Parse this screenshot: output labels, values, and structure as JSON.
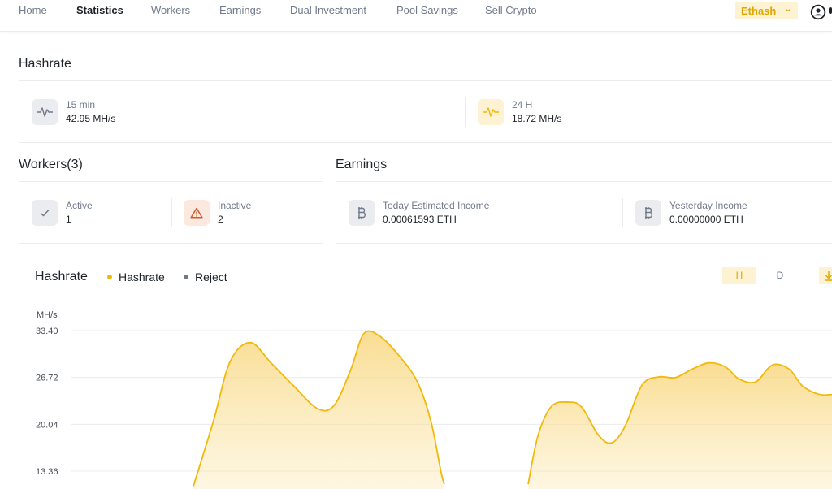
{
  "nav": {
    "items": [
      {
        "label": "Home",
        "active": false
      },
      {
        "label": "Statistics",
        "active": true
      },
      {
        "label": "Workers",
        "active": false
      },
      {
        "label": "Earnings",
        "active": false
      },
      {
        "label": "Dual Investment",
        "active": false
      },
      {
        "label": "Pool Savings",
        "active": false
      },
      {
        "label": "Sell Crypto",
        "active": false
      }
    ],
    "algorithm": "Ethash",
    "user_icon": "user-circle-icon"
  },
  "hashrate_section": {
    "title": "Hashrate",
    "min15": {
      "label": "15 min",
      "value": "42.95 MH/s",
      "icon": "pulse-icon"
    },
    "h24": {
      "label": "24 H",
      "value": "18.72 MH/s",
      "icon": "pulse-icon"
    }
  },
  "workers_section": {
    "title": "Workers(3)",
    "active": {
      "label": "Active",
      "value": "1",
      "icon": "check-icon"
    },
    "inactive": {
      "label": "Inactive",
      "value": "2",
      "icon": "warning-icon"
    }
  },
  "earnings_section": {
    "title": "Earnings",
    "today": {
      "label": "Today Estimated Income",
      "value": "0.00061593 ETH",
      "icon": "bitcoin-icon"
    },
    "yesterday": {
      "label": "Yesterday Income",
      "value": "0.00000000 ETH",
      "icon": "bitcoin-icon"
    }
  },
  "chart_header": {
    "title": "Hashrate",
    "legend": [
      "Hashrate",
      "Reject"
    ],
    "ranges": [
      "H",
      "D"
    ],
    "active_range": "H",
    "download_icon": "download-icon"
  },
  "colors": {
    "accent": "#f0b90b",
    "accent_light": "#fdf2d2",
    "reject": "#707a8a",
    "text": "#1e2329",
    "muted": "#707a8a"
  },
  "chart_data": {
    "type": "area",
    "ylabel": "MH/s",
    "ticks": [
      "33.40",
      "26.72",
      "20.04",
      "13.36"
    ],
    "tick_values": [
      33.4,
      26.72,
      20.04,
      13.36
    ],
    "series": [
      {
        "name": "Hashrate",
        "segments": [
          [
            [
              0.0,
              11.2
            ],
            [
              0.6,
              20.5
            ],
            [
              1.1,
              29.0
            ],
            [
              1.7,
              31.7
            ],
            [
              2.3,
              28.9
            ],
            [
              3.0,
              25.5
            ],
            [
              3.7,
              22.3
            ],
            [
              4.2,
              22.7
            ],
            [
              4.7,
              27.8
            ],
            [
              5.1,
              33.0
            ],
            [
              5.6,
              32.5
            ],
            [
              6.2,
              29.5
            ],
            [
              6.7,
              26.0
            ],
            [
              7.1,
              20.4
            ],
            [
              7.4,
              13.2
            ],
            [
              7.5,
              11.5
            ]
          ],
          [
            [
              10.0,
              11.5
            ],
            [
              10.3,
              18.5
            ],
            [
              10.7,
              22.6
            ],
            [
              11.2,
              23.2
            ],
            [
              11.6,
              22.5
            ],
            [
              12.1,
              18.5
            ],
            [
              12.5,
              17.4
            ],
            [
              12.9,
              19.8
            ],
            [
              13.4,
              25.6
            ],
            [
              13.9,
              26.8
            ],
            [
              14.4,
              26.7
            ],
            [
              14.9,
              27.9
            ],
            [
              15.4,
              28.8
            ],
            [
              15.9,
              28.2
            ],
            [
              16.3,
              26.5
            ],
            [
              16.8,
              26.1
            ],
            [
              17.3,
              28.5
            ],
            [
              17.8,
              27.9
            ],
            [
              18.2,
              25.5
            ],
            [
              18.7,
              24.3
            ],
            [
              19.1,
              24.3
            ]
          ]
        ]
      }
    ],
    "grid": true,
    "legend_position": "top"
  }
}
